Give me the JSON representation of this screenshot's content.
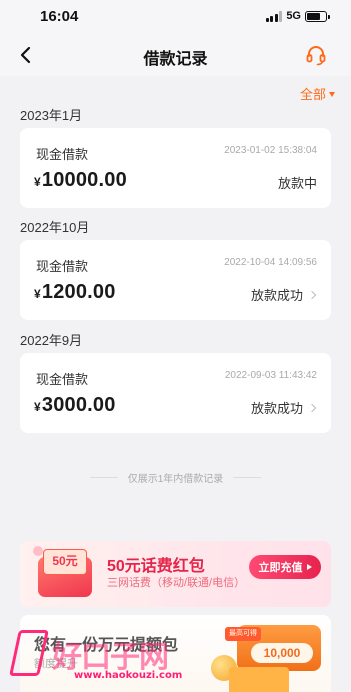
{
  "status_bar": {
    "time": "16:04",
    "network": "5G",
    "battery_level": 0.7
  },
  "nav": {
    "title": "借款记录",
    "back_icon": "chevron-left-icon",
    "service_icon": "headset-icon"
  },
  "filter": {
    "label": "全部",
    "icon": "caret-down-icon",
    "accent": "#ff6a1a"
  },
  "groups": [
    {
      "month": "2023年1月",
      "records": [
        {
          "type": "现金借款",
          "time": "2023-01-02 15:38:04",
          "currency": "¥",
          "amount": "10000.00",
          "status": "放款中",
          "has_chevron": false
        }
      ]
    },
    {
      "month": "2022年10月",
      "records": [
        {
          "type": "现金借款",
          "time": "2022-10-04 14:09:56",
          "currency": "¥",
          "amount": "1200.00",
          "status": "放款成功",
          "has_chevron": true
        }
      ]
    },
    {
      "month": "2022年9月",
      "records": [
        {
          "type": "现金借款",
          "time": "2022-09-03 11:43:42",
          "currency": "¥",
          "amount": "3000.00",
          "status": "放款成功",
          "has_chevron": true
        }
      ]
    }
  ],
  "footnote": "仅展示1年内借款记录",
  "promo": {
    "badge": "50元",
    "title": "50元话费红包",
    "subtitle": "三网话费（移动/联通/电信）",
    "button_label": "立即充值",
    "accent": "#e5254a"
  },
  "coupon_card": {
    "title": "您有一份万元提额包",
    "subtitle": "额度提升",
    "chip": "最高可得",
    "amount": "10,000"
  },
  "watermark": {
    "chars": "好口子网",
    "url": "www.haokouzi.com"
  }
}
